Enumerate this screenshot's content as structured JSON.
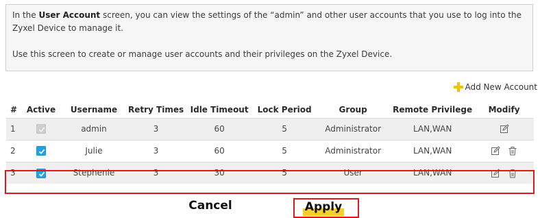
{
  "info": {
    "line1_pre": "In the ",
    "line1_bold": "User Account",
    "line1_post": " screen, you can view the settings of the “admin” and other user accounts that you use to log into the Zyxel Device to manage it.",
    "line2": "Use this screen to create or manage user accounts and their privileges on the Zyxel Device."
  },
  "add_account_label": "Add New Account",
  "columns": [
    "#",
    "Active",
    "Username",
    "Retry Times",
    "Idle Timeout",
    "Lock Period",
    "Group",
    "Remote Privilege",
    "Modify"
  ],
  "rows": [
    {
      "num": "1",
      "active": "disabled-checked",
      "username": "admin",
      "retry": "3",
      "idle": "60",
      "lock": "5",
      "group": "Administrator",
      "privilege": "LAN,WAN",
      "actions": [
        "edit-icon"
      ]
    },
    {
      "num": "2",
      "active": "checked",
      "username": "Julie",
      "retry": "3",
      "idle": "60",
      "lock": "5",
      "group": "Administrator",
      "privilege": "LAN,WAN",
      "actions": [
        "edit-icon",
        "trash-icon"
      ]
    },
    {
      "num": "3",
      "active": "checked",
      "username": "Stephenie",
      "retry": "3",
      "idle": "30",
      "lock": "5",
      "group": "User",
      "privilege": "LAN,WAN",
      "actions": [
        "edit-icon",
        "trash-icon"
      ]
    }
  ],
  "buttons": {
    "cancel": "Cancel",
    "apply": "Apply"
  },
  "colors": {
    "accent_blue": "#1ca3ec",
    "highlight_red": "#e01818",
    "plus_yellow": "#f2c100",
    "apply_yellow": "#f6cf2a"
  }
}
